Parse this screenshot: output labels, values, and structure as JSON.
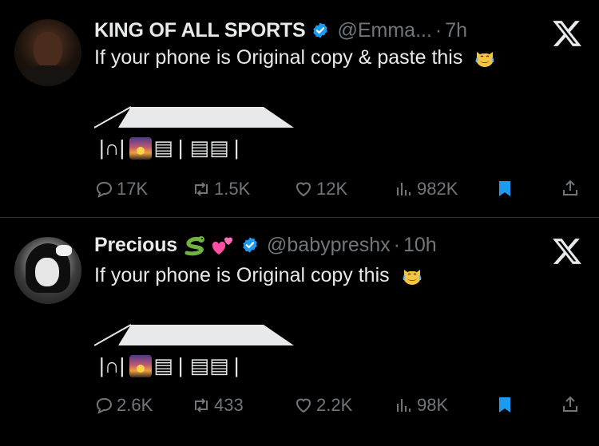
{
  "colors": {
    "background": "#000000",
    "text": "#e7e9ea",
    "muted": "#71767b",
    "verified": "#1d9bf0",
    "bookmark": "#1d9bf0",
    "divider": "#2f3336"
  },
  "tweets": [
    {
      "name": "KING OF ALL SPORTS",
      "handle": "@Emma...",
      "dot": "·",
      "time": "7h",
      "text": "If your phone is Original copy & paste this",
      "name_emojis": [],
      "text_emoji": "tears-of-joy-cat-emoji",
      "art": {
        "line1": "|∩|",
        "line2": "|",
        "blocks1": "▤",
        "blocks2": "▤▤",
        "end": "|"
      },
      "stats": {
        "replies": "17K",
        "reposts": "1.5K",
        "likes": "12K",
        "views": "982K"
      }
    },
    {
      "name": "Precious",
      "handle": "@babypreshx",
      "dot": "·",
      "time": "10h",
      "text": "If your phone is Original copy this",
      "name_emojis": [
        "snake-emoji",
        "two-hearts-emoji"
      ],
      "text_emoji": "tears-of-joy-cat-emoji",
      "art": {
        "line1": "|∩|",
        "line2": "|",
        "blocks1": "▤",
        "blocks2": "▤▤",
        "end": "|"
      },
      "stats": {
        "replies": "2.6K",
        "reposts": "433",
        "likes": "2.2K",
        "views": "98K"
      }
    }
  ]
}
